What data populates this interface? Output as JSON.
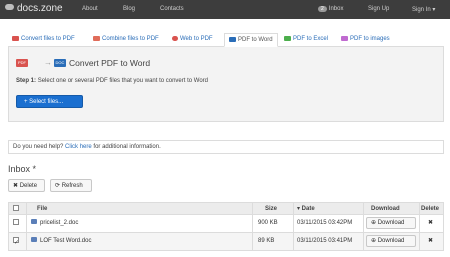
{
  "topbar": {
    "brand": "docs.zone",
    "nav": [
      "About",
      "Blog",
      "Contacts"
    ],
    "inbox_count": "2",
    "inbox_label": "Inbox",
    "signup": "Sign Up",
    "signin": "Sign In ▾"
  },
  "tabs": [
    {
      "label": "Convert files to PDF",
      "color": "#d9534f"
    },
    {
      "label": "Combine files to PDF",
      "color": "#e06c5a"
    },
    {
      "label": "Web to PDF",
      "color": "#d9534f"
    },
    {
      "label": "PDF to Word",
      "color": "#d9534f"
    },
    {
      "label": "PDF to Excel",
      "color": "#4cae4c"
    },
    {
      "label": "PDF to images",
      "color": "#c06ad0"
    }
  ],
  "converter": {
    "from_format": "PDF",
    "to_format": "DOC",
    "title": "Convert PDF to Word",
    "step_label": "Step 1:",
    "step_text": "Select one or several PDF files that you want to convert to Word",
    "select_button": "+ Select files..."
  },
  "help": {
    "before": "Do you need help?",
    "link": "Click here",
    "after": "for additional information."
  },
  "inbox": {
    "title": "Inbox *",
    "delete_button": "✖ Delete",
    "refresh_button": "⟳ Refresh",
    "columns": {
      "file": "File",
      "size": "Size",
      "date": "▾ Date",
      "download": "Download",
      "delete": "Delete"
    },
    "rows": [
      {
        "name": "pricelist_2.doc",
        "size": "900 KB",
        "date": "03/11/2015  03:42PM",
        "download": "Download",
        "checked": false
      },
      {
        "name": "LOF Test Word.doc",
        "size": "89 KB",
        "date": "03/11/2015  03:41PM",
        "download": "Download",
        "checked": true
      }
    ],
    "delete_icon": "✖"
  },
  "colors": {
    "accent": "#1a6fd0",
    "topbar": "#3d3d3d",
    "link": "#2a6db8"
  }
}
